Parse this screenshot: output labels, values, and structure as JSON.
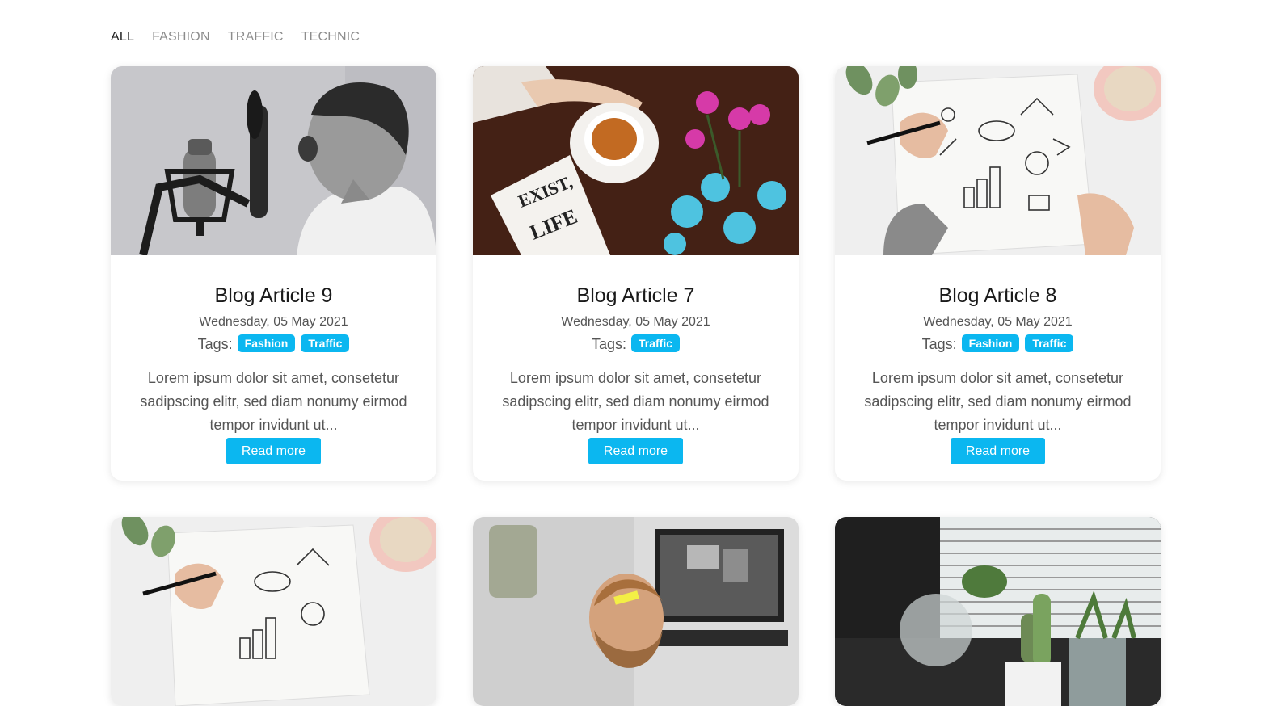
{
  "filters": [
    {
      "label": "ALL",
      "active": true
    },
    {
      "label": "FASHION",
      "active": false
    },
    {
      "label": "TRAFFIC",
      "active": false
    },
    {
      "label": "TECHNIC",
      "active": false
    }
  ],
  "cards": [
    {
      "title": "Blog Article 9",
      "date": "Wednesday, 05 May 2021",
      "tags_label": "Tags:",
      "tags": [
        "Fashion",
        "Traffic"
      ],
      "excerpt": "Lorem ipsum dolor sit amet, consetetur sadipscing elitr, sed diam nonumy eirmod tempor invidunt ut...",
      "button": "Read more",
      "image": "boy-singing-microphone-photo"
    },
    {
      "title": "Blog Article 7",
      "date": "Wednesday, 05 May 2021",
      "tags_label": "Tags:",
      "tags": [
        "Traffic"
      ],
      "excerpt": "Lorem ipsum dolor sit amet, consetetur sadipscing elitr, sed diam nonumy eirmod tempor invidunt ut...",
      "button": "Read more",
      "image": "coffee-flowers-notebook-photo"
    },
    {
      "title": "Blog Article 8",
      "date": "Wednesday, 05 May 2021",
      "tags_label": "Tags:",
      "tags": [
        "Fashion",
        "Traffic"
      ],
      "excerpt": "Lorem ipsum dolor sit amet, consetetur sadipscing elitr, sed diam nonumy eirmod tempor invidunt ut...",
      "button": "Read more",
      "image": "hands-drawing-business-doodles-photo"
    },
    {
      "image": "hands-drawing-business-doodles-photo"
    },
    {
      "image": "smiling-man-office-computer-photo"
    },
    {
      "image": "cactus-plants-window-blinds-photo"
    }
  ],
  "colors": {
    "accent": "#0bb7f0",
    "text": "#222222",
    "muted": "#8d8d8d"
  }
}
